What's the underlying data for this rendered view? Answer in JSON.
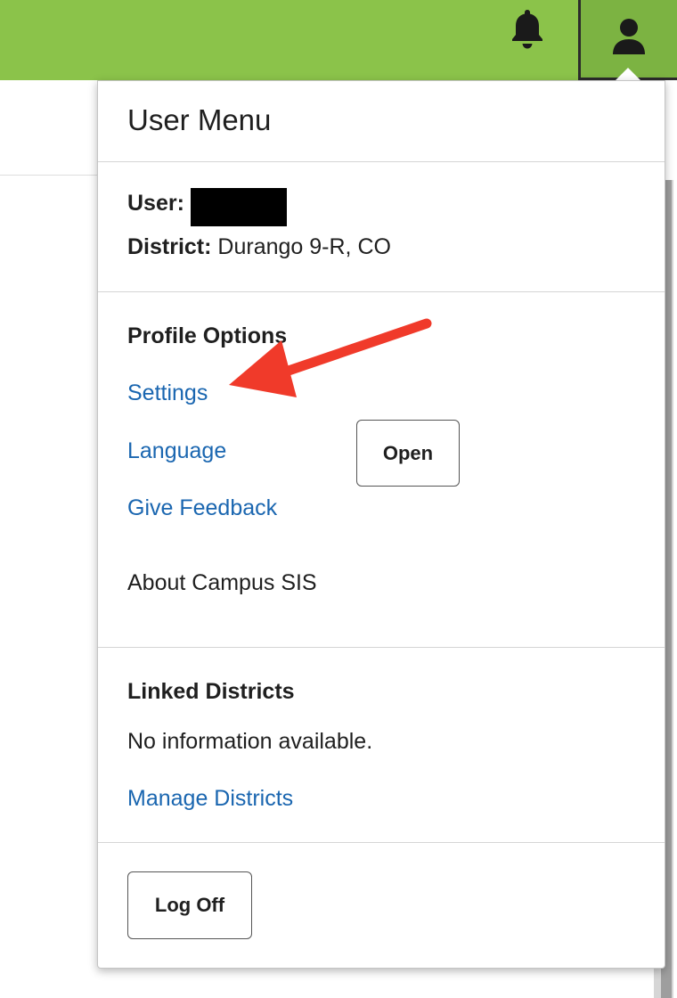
{
  "header": {
    "background_color": "#8bc34a",
    "notifications_icon": "bell-icon",
    "user_icon": "person-icon"
  },
  "menu": {
    "title": "User Menu",
    "user": {
      "label": "User:",
      "value_redacted": true
    },
    "district": {
      "label": "District:",
      "value": "Durango 9-R, CO"
    },
    "profile_options": {
      "heading": "Profile Options",
      "settings": "Settings",
      "language": "Language",
      "feedback": "Give Feedback",
      "about_label": "About Campus SIS",
      "about_button": "Open"
    },
    "linked_districts": {
      "heading": "Linked Districts",
      "empty_text": "No information available.",
      "manage_link": "Manage Districts"
    },
    "logoff_button": "Log Off"
  },
  "colors": {
    "link": "#1a66b0",
    "annotation_arrow": "#f03a2a"
  },
  "annotation": {
    "icon": "red-arrow-pointing-to-settings"
  }
}
